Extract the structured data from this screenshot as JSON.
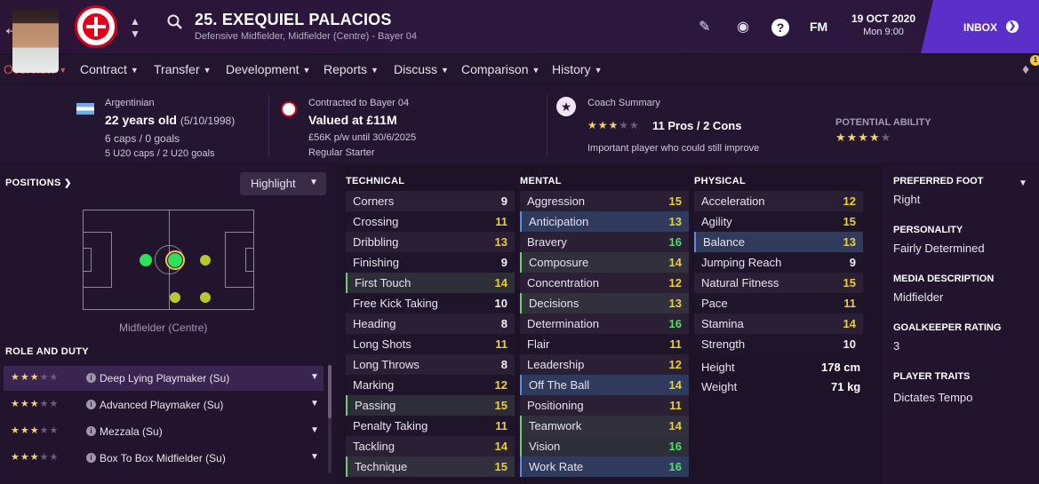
{
  "header": {
    "player_name": "25. EXEQUIEL PALACIOS",
    "player_subtitle": "Defensive Midfielder, Midfielder (Centre) - Bayer 04",
    "date": "19 OCT 2020",
    "time": "Mon 9:00",
    "inbox_label": "INBOX",
    "fm_label": "FM",
    "help_label": "?"
  },
  "tabs": [
    {
      "label": "Overview",
      "active": true
    },
    {
      "label": "Contract"
    },
    {
      "label": "Transfer"
    },
    {
      "label": "Development"
    },
    {
      "label": "Reports"
    },
    {
      "label": "Discuss"
    },
    {
      "label": "Comparison"
    },
    {
      "label": "History"
    }
  ],
  "notification_count": "1",
  "info": {
    "nationality": "Argentinian",
    "age": "22 years old",
    "dob": "(5/10/1998)",
    "caps": "6 caps / 0 goals",
    "u20_caps": "5 U20 caps / 2 U20 goals",
    "contract_club": "Contracted to Bayer 04",
    "value": "Valued at £11M",
    "wage": "£56K p/w until 30/6/2025",
    "squad_status": "Regular Starter",
    "coach_summary_label": "Coach Summary",
    "coach_stars": 3,
    "coach_stars_max": 5,
    "pros_cons": "11 Pros / 2 Cons",
    "coach_note": "Important player who could still improve",
    "potential_label": "POTENTIAL ABILITY",
    "potential_stars": 4,
    "potential_stars_max": 5
  },
  "positions": {
    "title": "POSITIONS",
    "highlight_label": "Highlight",
    "selected_position": "Midfielder (Centre)"
  },
  "role_duty": {
    "title": "ROLE AND DUTY",
    "roles": [
      {
        "name": "Deep Lying Playmaker (Su)",
        "stars": 3,
        "selected": true
      },
      {
        "name": "Advanced Playmaker (Su)",
        "stars": 3
      },
      {
        "name": "Mezzala (Su)",
        "stars": 3
      },
      {
        "name": "Box To Box Midfielder (Su)",
        "stars": 3
      }
    ]
  },
  "attributes": {
    "technical_title": "TECHNICAL",
    "mental_title": "MENTAL",
    "physical_title": "PHYSICAL",
    "technical": [
      {
        "name": "Corners",
        "value": "9"
      },
      {
        "name": "Crossing",
        "value": "11"
      },
      {
        "name": "Dribbling",
        "value": "13"
      },
      {
        "name": "Finishing",
        "value": "9"
      },
      {
        "name": "First Touch",
        "value": "14",
        "hl": "green"
      },
      {
        "name": "Free Kick Taking",
        "value": "10"
      },
      {
        "name": "Heading",
        "value": "8"
      },
      {
        "name": "Long Shots",
        "value": "11"
      },
      {
        "name": "Long Throws",
        "value": "8"
      },
      {
        "name": "Marking",
        "value": "12"
      },
      {
        "name": "Passing",
        "value": "15",
        "hl": "green"
      },
      {
        "name": "Penalty Taking",
        "value": "11"
      },
      {
        "name": "Tackling",
        "value": "14"
      },
      {
        "name": "Technique",
        "value": "15",
        "hl": "green"
      }
    ],
    "mental": [
      {
        "name": "Aggression",
        "value": "15"
      },
      {
        "name": "Anticipation",
        "value": "13",
        "hl": "blue"
      },
      {
        "name": "Bravery",
        "value": "16"
      },
      {
        "name": "Composure",
        "value": "14",
        "hl": "green"
      },
      {
        "name": "Concentration",
        "value": "12"
      },
      {
        "name": "Decisions",
        "value": "13",
        "hl": "green"
      },
      {
        "name": "Determination",
        "value": "16"
      },
      {
        "name": "Flair",
        "value": "11"
      },
      {
        "name": "Leadership",
        "value": "12"
      },
      {
        "name": "Off The Ball",
        "value": "14",
        "hl": "blue"
      },
      {
        "name": "Positioning",
        "value": "11"
      },
      {
        "name": "Teamwork",
        "value": "14",
        "hl": "green"
      },
      {
        "name": "Vision",
        "value": "16",
        "hl": "green"
      },
      {
        "name": "Work Rate",
        "value": "16",
        "hl": "blue"
      }
    ],
    "physical": [
      {
        "name": "Acceleration",
        "value": "12"
      },
      {
        "name": "Agility",
        "value": "15"
      },
      {
        "name": "Balance",
        "value": "13",
        "hl": "blue"
      },
      {
        "name": "Jumping Reach",
        "value": "9"
      },
      {
        "name": "Natural Fitness",
        "value": "15"
      },
      {
        "name": "Pace",
        "value": "11"
      },
      {
        "name": "Stamina",
        "value": "14"
      },
      {
        "name": "Strength",
        "value": "10"
      }
    ],
    "height_label": "Height",
    "height": "178 cm",
    "weight_label": "Weight",
    "weight": "71 kg"
  },
  "side": {
    "foot_label": "PREFERRED FOOT",
    "foot": "Right",
    "personality_label": "PERSONALITY",
    "personality": "Fairly Determined",
    "media_label": "MEDIA DESCRIPTION",
    "media": "Midfielder",
    "gk_label": "GOALKEEPER RATING",
    "gk": "3",
    "traits_label": "PLAYER TRAITS",
    "traits": "Dictates Tempo"
  },
  "colors": {
    "accent_tab": "#e2504d",
    "inbox": "#5b2fc9",
    "value_white": "#f2f2f2",
    "value_yellow": "#e9d03a",
    "value_green": "#52e06b"
  }
}
